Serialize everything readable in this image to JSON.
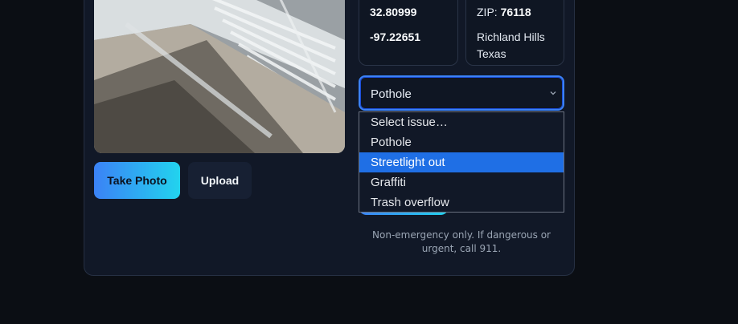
{
  "location": {
    "latitude": "32.80999",
    "longitude": "-97.22651",
    "zip_label": "ZIP:",
    "zip": "76118",
    "city": "Richland Hills",
    "state": "Texas"
  },
  "photo_actions": {
    "take_photo": "Take Photo",
    "upload": "Upload"
  },
  "issue_select": {
    "selected": "Pothole",
    "highlighted": "Streetlight out",
    "options": [
      "Select issue…",
      "Pothole",
      "Streetlight out",
      "Graffiti",
      "Trash overflow"
    ]
  },
  "footer_note": "Non-emergency only. If dangerous or urgent, call 911.",
  "colors": {
    "accent_start": "#3b82f6",
    "accent_end": "#22d3ee",
    "highlight": "#1f6fe5",
    "card_bg": "#111827"
  },
  "icons": {
    "select_arrow": "chevron-down-icon"
  }
}
